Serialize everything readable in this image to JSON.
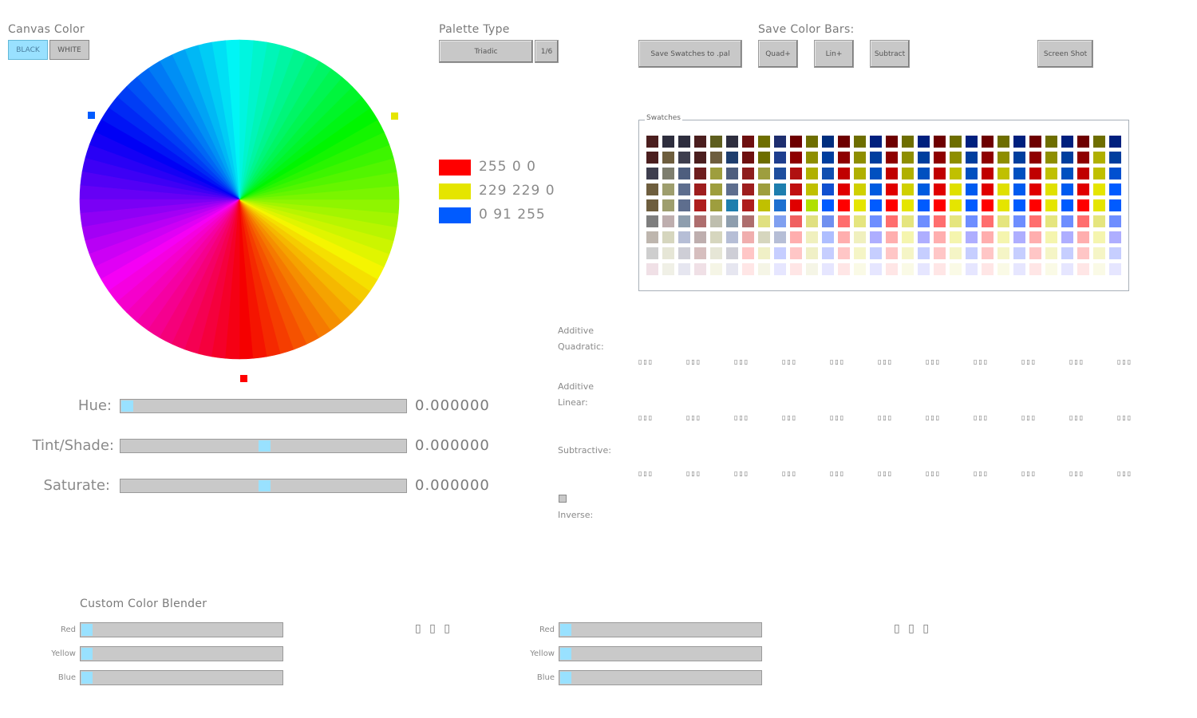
{
  "canvas_color": {
    "title": "Canvas Color",
    "options": [
      "BLACK",
      "WHITE"
    ],
    "selected": "BLACK"
  },
  "palette_type": {
    "title": "Palette Type",
    "value": "Triadic",
    "step": "1/6"
  },
  "save_color_bars": {
    "title": "Save Color Bars:",
    "buttons": {
      "save_pal": "Save Swatches to .pal",
      "quad": "Quad+",
      "lin": "Lin+",
      "subtract": "Subtract",
      "screenshot": "Screen Shot"
    }
  },
  "palette_colors": [
    {
      "rgb": "255 0 0",
      "hex": "#ff0000"
    },
    {
      "rgb": "229 229 0",
      "hex": "#e5e500"
    },
    {
      "rgb": "0 91 255",
      "hex": "#005bff"
    }
  ],
  "sliders": [
    {
      "label": "Hue:",
      "value": "0.000000",
      "level": 0.0
    },
    {
      "label": "Tint/Shade:",
      "value": "0.000000",
      "level": 0.5
    },
    {
      "label": "Saturate:",
      "value": "0.000000",
      "level": 0.5
    }
  ],
  "swatches": {
    "title": "Swatches",
    "rows": [
      [
        "#4b1e1e",
        "#2e2e3e",
        "#2e2e3e",
        "#4b1e1e",
        "#5e5e1e",
        "#2e2e3e",
        "#6e1010",
        "#6e6e00",
        "#1e2e6e",
        "#6e0000",
        "#6e6e00",
        "#002e7e",
        "#6e0000",
        "#6e6e00",
        "#00207e",
        "#6e0000",
        "#6e6e00",
        "#00207e",
        "#6e0000",
        "#6e6e00",
        "#00207e",
        "#6e0000",
        "#6e6e00",
        "#00207e",
        "#6e0000",
        "#6e6e00",
        "#00207e",
        "#6e0000",
        "#6e6e00",
        "#00207e"
      ],
      [
        "#4b1e1e",
        "#6e5e3e",
        "#3e3e4e",
        "#4b1e1e",
        "#6e5e3e",
        "#1e3e6e",
        "#6e1010",
        "#6e6e00",
        "#1e3e8e",
        "#8e0000",
        "#8e8e00",
        "#003e9e",
        "#8e0000",
        "#8e8e00",
        "#003e9e",
        "#8e0000",
        "#8e8e00",
        "#003e9e",
        "#8e0000",
        "#8e8e00",
        "#003e9e",
        "#8e0000",
        "#8e8e00",
        "#003e9e",
        "#8e0000",
        "#8e8e00",
        "#003e9e",
        "#8e0000",
        "#b0b000",
        "#003e9e"
      ],
      [
        "#3e3e4e",
        "#7e7e6e",
        "#4e5e7e",
        "#6e1e1e",
        "#9e9e3e",
        "#4e5e7e",
        "#8e1e1e",
        "#9e9e3e",
        "#1e4e9e",
        "#b01010",
        "#b0b000",
        "#104eb0",
        "#c00000",
        "#b0b000",
        "#0050c0",
        "#c00000",
        "#b0b000",
        "#0050c0",
        "#c00000",
        "#c0c000",
        "#0050c0",
        "#c00000",
        "#c0c000",
        "#0050c0",
        "#c00000",
        "#c0c000",
        "#0050c0",
        "#c00000",
        "#c0c000",
        "#0050d0"
      ],
      [
        "#6e5e3e",
        "#9e9e6e",
        "#5e6e8e",
        "#9e1e1e",
        "#9e9e3e",
        "#5e6e8e",
        "#9e1e1e",
        "#9e9e3e",
        "#1e7eae",
        "#c01010",
        "#c0c000",
        "#1050d0",
        "#e00000",
        "#d0d000",
        "#005be0",
        "#e00000",
        "#d0d000",
        "#005be0",
        "#e00000",
        "#e0e000",
        "#005bf0",
        "#e00000",
        "#e0e000",
        "#005bf0",
        "#e00000",
        "#e0e000",
        "#005bf0",
        "#e00000",
        "#e5e500",
        "#005bff"
      ],
      [
        "#6e5e3e",
        "#9e9e6e",
        "#5e6e8e",
        "#ae1e1e",
        "#9e9e3e",
        "#1e7eae",
        "#ae1e1e",
        "#c0c000",
        "#1e70d0",
        "#e00000",
        "#b0e000",
        "#005bff",
        "#ff0000",
        "#e5e500",
        "#005bff",
        "#ff0000",
        "#e5e500",
        "#005bff",
        "#ff0000",
        "#e5e500",
        "#005bff",
        "#ff0000",
        "#e5e500",
        "#005bff",
        "#ff0000",
        "#e5e500",
        "#005bff",
        "#ff0000",
        "#e5e500",
        "#005bff"
      ],
      [
        "#7e7e7e",
        "#beaeae",
        "#8e9eae",
        "#ae6e6e",
        "#bebeae",
        "#8e9eae",
        "#ae6e6e",
        "#e0e080",
        "#80a0f0",
        "#f06060",
        "#e0e080",
        "#7090f0",
        "#ff6e6e",
        "#e5e57e",
        "#6e8eff",
        "#ff6e6e",
        "#e5e57e",
        "#6e8eff",
        "#ff6e6e",
        "#e5e57e",
        "#6e8eff",
        "#ff6e6e",
        "#e5e57e",
        "#6e8eff",
        "#ff6e6e",
        "#e5e57e",
        "#6e8eff",
        "#ff6e6e",
        "#e5e57e",
        "#6e8eff"
      ],
      [
        "#beb6ae",
        "#d6d6be",
        "#b6bed6",
        "#beaeae",
        "#d6d6be",
        "#b6bed6",
        "#f0aeae",
        "#d6d6be",
        "#b6bed6",
        "#ffaeae",
        "#f0f0be",
        "#aebeff",
        "#ffaeae",
        "#f0f0be",
        "#aeaeff",
        "#ffaeae",
        "#f5f5ae",
        "#aeaeff",
        "#ffaeae",
        "#f5f5ae",
        "#aeaeff",
        "#ffaeae",
        "#f5f5ae",
        "#aeaeff",
        "#ffaeae",
        "#f5f5ae",
        "#aeaeff",
        "#ffaeae",
        "#f5f5ae",
        "#aeaeff"
      ],
      [
        "#cecece",
        "#e6e6d6",
        "#ceced6",
        "#d6bebe",
        "#e6e6d6",
        "#ceced6",
        "#ffc6c6",
        "#f0f0c6",
        "#c6ceff",
        "#ffc6c6",
        "#f0f0c6",
        "#c6ceff",
        "#ffc6c6",
        "#f5f5c6",
        "#c6ceff",
        "#ffc6c6",
        "#f5f5c6",
        "#c6ceff",
        "#ffc6c6",
        "#f5f5c6",
        "#c6ceff",
        "#ffc6c6",
        "#f5f5c6",
        "#c6ceff",
        "#ffc6c6",
        "#f5f5c6",
        "#c6ceff",
        "#ffc6c6",
        "#f5f5c6",
        "#c6ceff"
      ],
      [
        "#f0e0e6",
        "#f0f0e6",
        "#e6e6f0",
        "#f0e0e6",
        "#f5f5e6",
        "#e6e6f0",
        "#ffe6e6",
        "#f5f5e6",
        "#e6e6ff",
        "#ffe6e6",
        "#f5f5e6",
        "#e6e6ff",
        "#ffe6e6",
        "#fafae6",
        "#e6e6ff",
        "#ffe6e6",
        "#fafae6",
        "#e6e6ff",
        "#ffe6e6",
        "#fafae6",
        "#e6e6ff",
        "#ffe6e6",
        "#fafae6",
        "#e6e6ff",
        "#ffe6e6",
        "#fafae6",
        "#e6e6ff",
        "#ffe6e6",
        "#fafae6",
        "#e6e6ff"
      ]
    ]
  },
  "blend_sections": {
    "additive_quadratic": "Additive\nQuadratic:",
    "additive_linear": "Additive\nLinear:",
    "subtractive": "Subtractive:",
    "inverse": "Inverse:",
    "dot_text": "▯▯▯"
  },
  "custom_blender": {
    "title": "Custom Color Blender",
    "labels": [
      "Red",
      "Yellow",
      "Blue"
    ],
    "readout": "▯ ▯ ▯"
  },
  "wheel": {
    "marker_colors": [
      "#005bff",
      "#e5e500",
      "#ff0000"
    ]
  }
}
